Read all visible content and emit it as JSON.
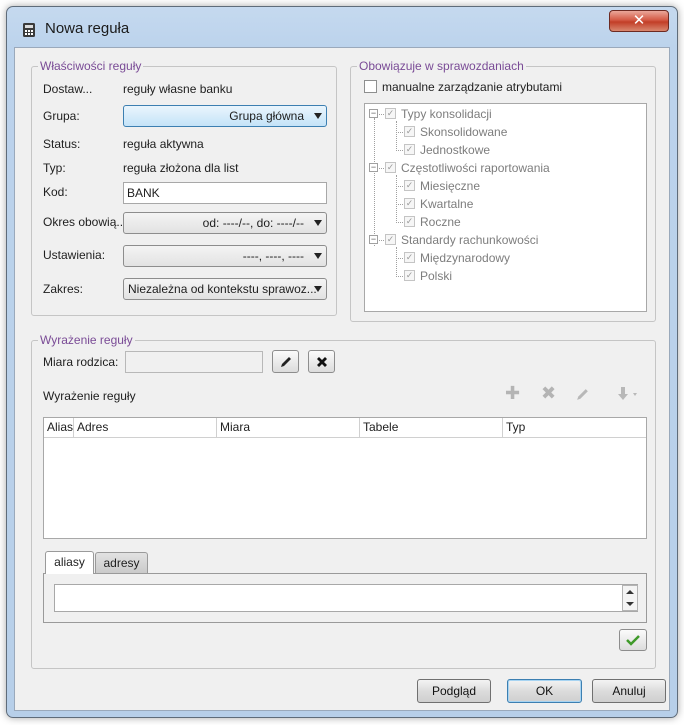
{
  "window": {
    "title": "Nowa reguła",
    "close_glyph": "✕",
    "icon": "calculator-icon"
  },
  "properties": {
    "legend": "Właściwości reguły",
    "rows": {
      "dostawca_label": "Dostaw...",
      "dostawca_value": "reguły własne banku",
      "grupa_label": "Grupa:",
      "grupa_value": "Grupa główna",
      "status_label": "Status:",
      "status_value": "reguła aktywna",
      "typ_label": "Typ:",
      "typ_value": "reguła złożona dla list",
      "kod_label": "Kod:",
      "kod_value": "BANK",
      "okres_label": "Okres obowią...",
      "okres_value": "od: ----/--, do: ----/--",
      "ustawienia_label": "Ustawienia:",
      "ustawienia_value": "----, ----, ----",
      "zakres_label": "Zakres:",
      "zakres_value": "Niezależna od kontekstu sprawoz..."
    }
  },
  "reports": {
    "legend": "Obowiązuje w sprawozdaniach",
    "manual_label": "manualne zarządzanie atrybutami",
    "tree": {
      "g1": "Typy konsolidacji",
      "g1c1": "Skonsolidowane",
      "g1c2": "Jednostkowe",
      "g2": "Częstotliwości raportowania",
      "g2c1": "Miesięczne",
      "g2c2": "Kwartalne",
      "g2c3": "Roczne",
      "g3": "Standardy rachunkowości",
      "g3c1": "Międzynarodowy",
      "g3c2": "Polski"
    }
  },
  "expression": {
    "legend": "Wyrażenie reguły",
    "parent_label": "Miara rodzica:",
    "parent_value": "",
    "section_label": "Wyrażenie reguły",
    "columns": [
      "Alias",
      "Adres",
      "Miara",
      "Tabele",
      "Typ"
    ],
    "tabs": [
      "aliasy",
      "adresy"
    ]
  },
  "buttons": {
    "preview": "Podgląd",
    "ok": "OK",
    "cancel": "Anuluj"
  }
}
